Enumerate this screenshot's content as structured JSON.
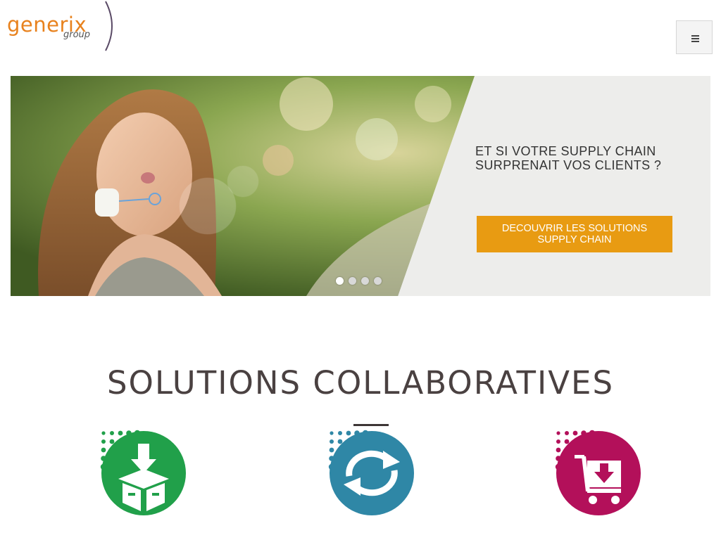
{
  "header": {
    "logo_text": "generix",
    "logo_sub": "group",
    "menu_icon": "hamburger-menu-icon"
  },
  "slider": {
    "title_line1": "ET SI VOTRE SUPPLY CHAIN",
    "title_line2": "SURPRENAIT VOS CLIENTS ?",
    "cta_line1": "DECOUVRIR LES SOLUTIONS",
    "cta_line2": "SUPPLY CHAIN",
    "slide_count": 4,
    "active_slide": 1
  },
  "section": {
    "title": "SOLUTIONS COLLABORATIVES"
  },
  "solutions": [
    {
      "icon": "box-download-icon",
      "color": "#21a04a"
    },
    {
      "icon": "sync-arrows-icon",
      "color": "#2f87a6"
    },
    {
      "icon": "cart-download-icon",
      "color": "#b3105a"
    }
  ],
  "colors": {
    "brand_orange": "#e8821e",
    "cta_orange": "#e89b12",
    "title_text": "#4a4141"
  }
}
